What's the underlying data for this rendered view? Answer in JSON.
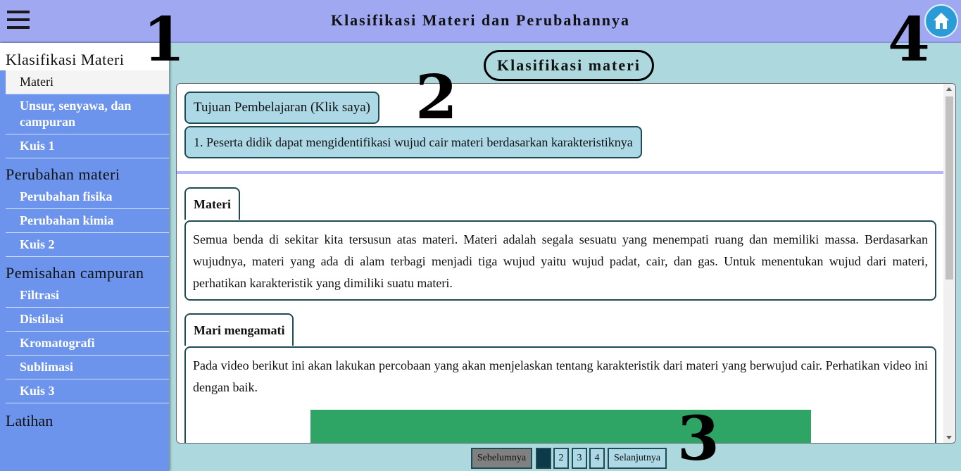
{
  "header": {
    "title": "Klasifikasi Materi dan Perubahannya"
  },
  "annotations": [
    "1",
    "2",
    "3",
    "4"
  ],
  "sidebar": {
    "sections": [
      {
        "label": "Klasifikasi Materi",
        "items": [
          "Materi",
          "Unsur, senyawa, dan campuran",
          "Kuis 1"
        ]
      },
      {
        "label": "Perubahan materi",
        "items": [
          "Perubahan fisika",
          "Perubahan kimia",
          "Kuis 2"
        ]
      },
      {
        "label": "Pemisahan campuran",
        "items": [
          "Filtrasi",
          "Distilasi",
          "Kromatografi",
          "Sublimasi",
          "Kuis 3"
        ]
      }
    ],
    "latihan": "Latihan",
    "active_item": "Materi"
  },
  "main": {
    "section_title": "Klasifikasi materi",
    "tujuan_button": "Tujuan Pembelajaran (Klik saya)",
    "tujuan_item": "1. Peserta didik dapat mengidentifikasi wujud cair materi berdasarkan karakteristiknya",
    "cards": [
      {
        "title": "Materi",
        "text": "Semua benda di sekitar kita tersusun atas materi. Materi adalah segala sesuatu yang menempati ruang dan memiliki massa. Berdasarkan wujudnya, materi yang ada di alam terbagi menjadi tiga wujud yaitu wujud padat, cair, dan gas. Untuk menentukan wujud dari materi, perhatikan karakteristik yang dimiliki suatu materi."
      },
      {
        "title": "Mari mengamati",
        "text": "Pada video berikut ini akan lakukan percobaan yang akan menjelaskan tentang karakteristik dari materi yang berwujud cair. Perhatikan video ini dengan baik."
      }
    ]
  },
  "pagination": {
    "prev": "Sebelumnya",
    "pages": [
      "1",
      "2",
      "3",
      "4"
    ],
    "current": "1",
    "next": "Selanjutnya"
  },
  "colors": {
    "header_bg": "#9fa8f0",
    "sidebar_bg": "#6c94ec",
    "main_bg": "#add8de",
    "home_button": "#2b9bd8",
    "video_placeholder": "#2ea465"
  },
  "icons": [
    "hamburger-menu-icon",
    "home-icon"
  ]
}
